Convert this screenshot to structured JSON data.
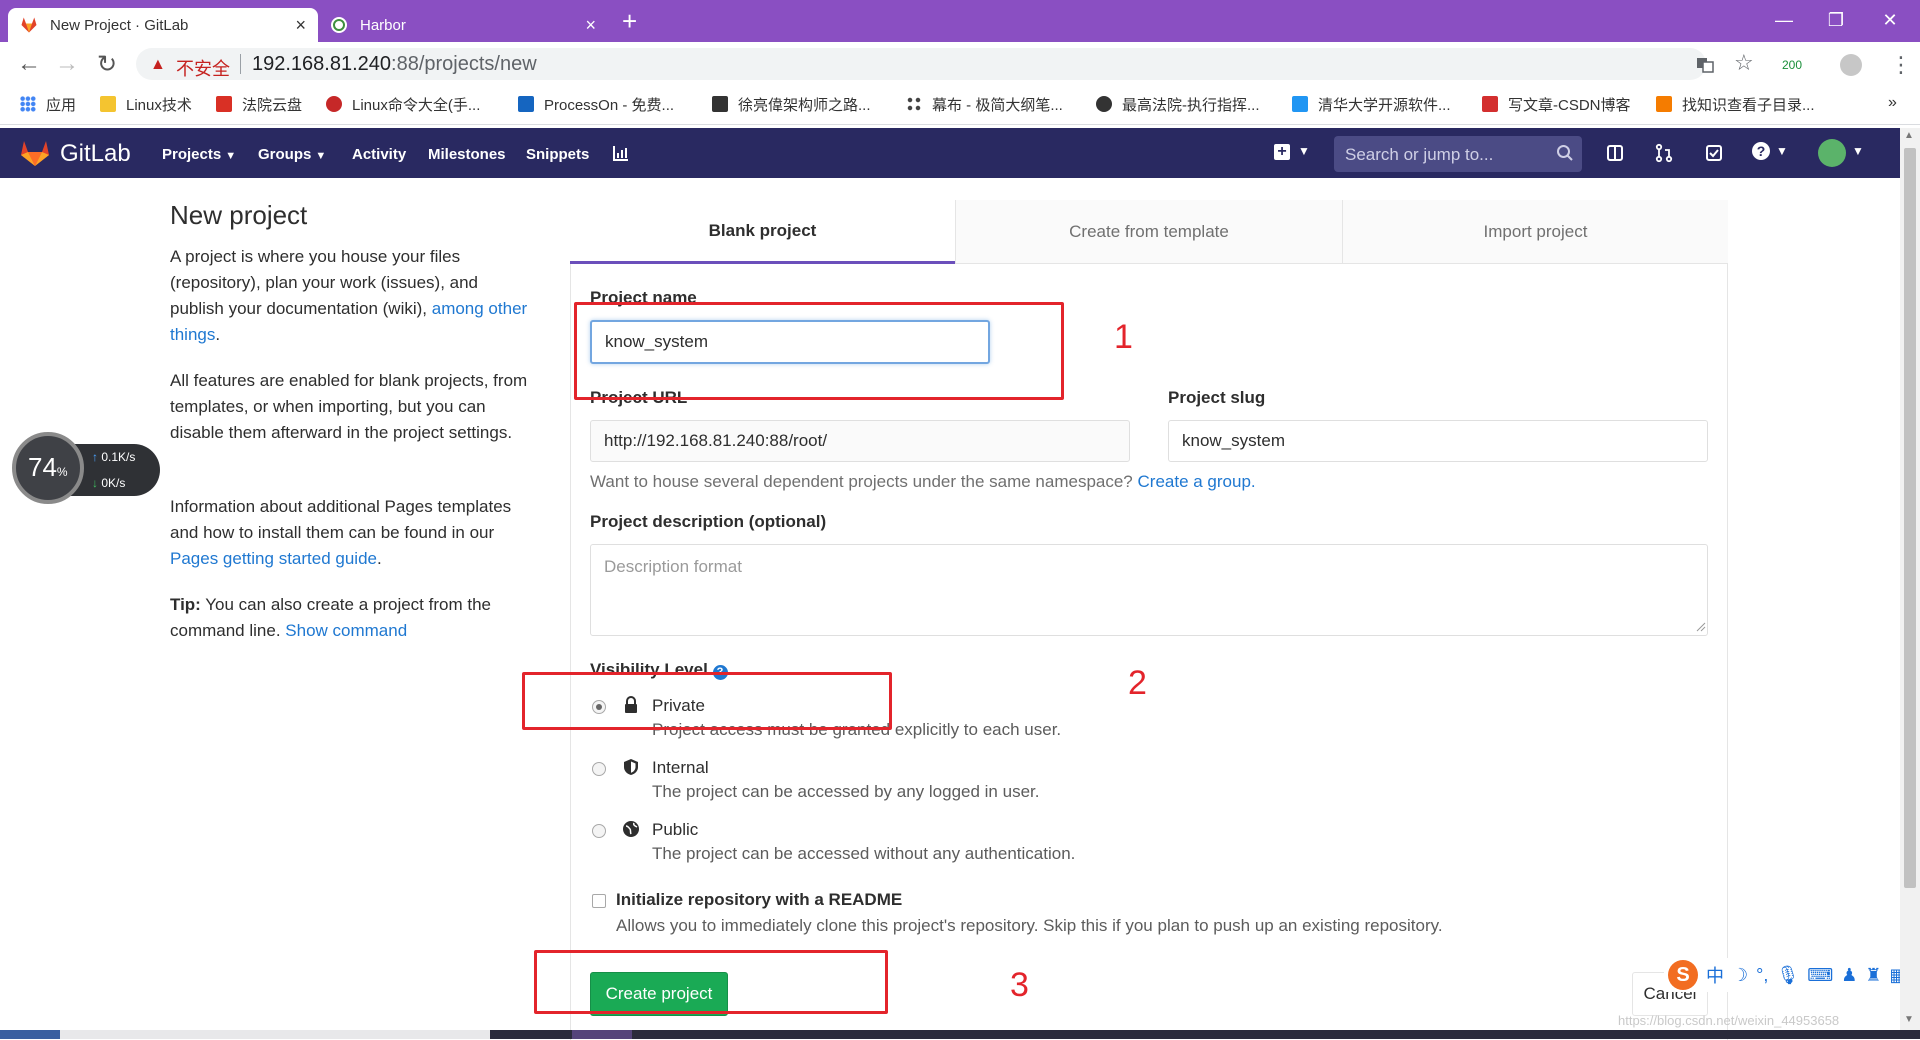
{
  "browser": {
    "tabs": [
      {
        "title": "New Project · GitLab",
        "active": true,
        "icon": "gitlab-icon"
      },
      {
        "title": "Harbor",
        "active": false,
        "icon": "harbor-icon"
      }
    ],
    "new_tab": "+",
    "insecure_label": "不安全",
    "url_host": "192.168.81.240",
    "url_rest": ":88/projects/new",
    "extension_badge": "200",
    "bookmarks": [
      {
        "label": "应用",
        "color": "#4285f4"
      },
      {
        "label": "Linux技术",
        "color": "#f4c430"
      },
      {
        "label": "法院云盘",
        "color": "#d93025"
      },
      {
        "label": "Linux命令大全(手...",
        "color": "#c62828"
      },
      {
        "label": "ProcessOn - 免费...",
        "color": "#1565c0"
      },
      {
        "label": "徐亮偉架构师之路...",
        "color": "#333333"
      },
      {
        "label": "幕布 - 极简大纲笔...",
        "color": "#444444"
      },
      {
        "label": "最高法院-执行指挥...",
        "color": "#333333"
      },
      {
        "label": "清华大学开源软件...",
        "color": "#2196f3"
      },
      {
        "label": "写文章-CSDN博客",
        "color": "#d32f2f"
      },
      {
        "label": "找知识查看子目录...",
        "color": "#f57c00"
      }
    ],
    "bookmarks_more": "»"
  },
  "gitlab": {
    "brand": "GitLab",
    "nav": [
      {
        "label": "Projects",
        "caret": true
      },
      {
        "label": "Groups",
        "caret": true
      },
      {
        "label": "Activity",
        "caret": false
      },
      {
        "label": "Milestones",
        "caret": false
      },
      {
        "label": "Snippets",
        "caret": false
      }
    ],
    "search_placeholder": "Search or jump to...",
    "header_color": "#292961"
  },
  "intro": {
    "title": "New project",
    "p1_text": "A project is where you house your files (repository), plan your work (issues), and publish your documentation (wiki), ",
    "p1_link": "among other things",
    "p1_end": ".",
    "p2": "All features are enabled for blank projects, from templates, or when importing, but you can disable them afterward in the project settings.",
    "p3_text": "Information about additional Pages templates and how to install them can be found in our ",
    "p3_link": "Pages getting started guide",
    "p3_end": ".",
    "tip_label": "Tip:",
    "tip_text": " You can also create a project from the command line. ",
    "tip_link": "Show command"
  },
  "speed": {
    "percent": "74",
    "percent_sign": "%",
    "up": "0.1K/s",
    "down": "0K/s"
  },
  "tabs": {
    "blank": "Blank project",
    "template": "Create from template",
    "import": "Import project"
  },
  "form": {
    "name_label": "Project name",
    "name_value": "know_system",
    "url_label": "Project URL",
    "url_value": "http://192.168.81.240:88/root/",
    "slug_label": "Project slug",
    "slug_value": "know_system",
    "namespace_hint": "Want to house several dependent projects under the same namespace? ",
    "namespace_link": "Create a group.",
    "desc_label": "Project description (optional)",
    "desc_placeholder": "Description format",
    "visibility_label": "Visibility Level",
    "visibility": [
      {
        "label": "Private",
        "desc": "Project access must be granted explicitly to each user.",
        "checked": true,
        "icon": "lock-icon"
      },
      {
        "label": "Internal",
        "desc": "The project can be accessed by any logged in user.",
        "checked": false,
        "icon": "shield-icon"
      },
      {
        "label": "Public",
        "desc": "The project can be accessed without any authentication.",
        "checked": false,
        "icon": "globe-icon"
      }
    ],
    "readme_label": "Initialize repository with a README",
    "readme_desc": "Allows you to immediately clone this project's repository. Skip this if you plan to push up an existing repository.",
    "create_button": "Create project",
    "cancel_button": "Cancel"
  },
  "annotations": [
    "1",
    "2",
    "3"
  ],
  "ime": {
    "logo": "S",
    "lang": "中"
  },
  "watermark": "https://blog.csdn.net/weixin_44953658"
}
